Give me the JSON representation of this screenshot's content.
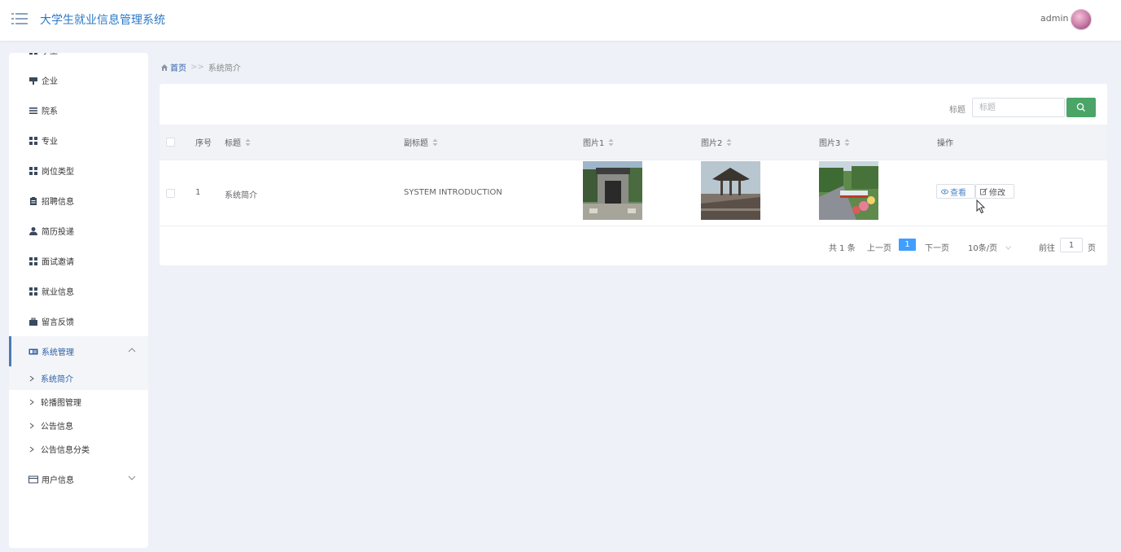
{
  "header": {
    "title": "大学生就业信息管理系统",
    "user": "admin"
  },
  "colors": {
    "accent": "#2d5fa4",
    "title": "#2c79c7",
    "search_button": "#4aa567",
    "page_active": "#409eff"
  },
  "sidebar": {
    "items": [
      {
        "label": "学生",
        "icon": "grid-icon"
      },
      {
        "label": "企业",
        "icon": "company-icon"
      },
      {
        "label": "院系",
        "icon": "list-icon"
      },
      {
        "label": "专业",
        "icon": "grid-icon"
      },
      {
        "label": "岗位类型",
        "icon": "grid-icon"
      },
      {
        "label": "招聘信息",
        "icon": "clipboard-icon"
      },
      {
        "label": "简历投递",
        "icon": "user-icon"
      },
      {
        "label": "面试邀请",
        "icon": "grid-icon"
      },
      {
        "label": "就业信息",
        "icon": "grid-icon"
      },
      {
        "label": "留言反馈",
        "icon": "briefcase-icon"
      }
    ],
    "system_menu": {
      "label": "系统管理",
      "icon": "settings-card-icon",
      "children": [
        "系统简介",
        "轮播图管理",
        "公告信息",
        "公告信息分类"
      ]
    },
    "user_menu": {
      "label": "用户信息",
      "icon": "id-card-icon"
    }
  },
  "breadcrumb": {
    "home": "首页",
    "separator": ">>",
    "current": "系统简介"
  },
  "search": {
    "label": "标题",
    "placeholder": "标题"
  },
  "table": {
    "headers": [
      "序号",
      "标题",
      "副标题",
      "图片1",
      "图片2",
      "图片3",
      "操作"
    ],
    "rows": [
      {
        "index": "1",
        "title": "系统简介",
        "subtitle": "SYSTEM INTRODUCTION",
        "images": [
          "gate-photo",
          "pavilion-photo",
          "garden-photo"
        ]
      }
    ],
    "actions": {
      "view": "查看",
      "edit": "修改"
    }
  },
  "pagination": {
    "total": "共 1 条",
    "prev": "上一页",
    "current": "1",
    "next": "下一页",
    "page_size": "10条/页",
    "goto": "前往",
    "goto_value": "1",
    "page_unit": "页"
  }
}
